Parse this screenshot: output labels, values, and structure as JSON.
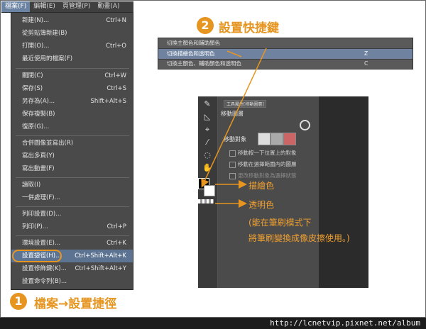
{
  "menubar": {
    "items": [
      {
        "label": "檔案(F)",
        "active": true
      },
      {
        "label": "編輯(E)",
        "active": false
      },
      {
        "label": "頁管理(P)",
        "active": false
      },
      {
        "label": "動畫(A)",
        "active": false
      }
    ]
  },
  "file_menu": {
    "items": [
      {
        "label": "新建(N)...",
        "shortcut": "Ctrl+N"
      },
      {
        "label": "從剪貼簿新建(B)",
        "shortcut": ""
      },
      {
        "label": "打開(O)...",
        "shortcut": "Ctrl+O"
      },
      {
        "label": "最近使用的檔案(F)",
        "shortcut": ""
      },
      {
        "label": "關閉(C)",
        "shortcut": "Ctrl+W"
      },
      {
        "label": "保存(S)",
        "shortcut": "Ctrl+S"
      },
      {
        "label": "另存為(A)...",
        "shortcut": "Shift+Alt+S"
      },
      {
        "label": "保存複製(B)",
        "shortcut": ""
      },
      {
        "label": "復原(G)...",
        "shortcut": ""
      },
      {
        "label": "合併圖像並寫出(R)",
        "shortcut": ""
      },
      {
        "label": "寫出多頁(Y)",
        "shortcut": ""
      },
      {
        "label": "寫出動畫(F)",
        "shortcut": ""
      },
      {
        "label": "讀取(I)",
        "shortcut": ""
      },
      {
        "label": "一併處理(F)...",
        "shortcut": ""
      },
      {
        "label": "列印設置(D)...",
        "shortcut": ""
      },
      {
        "label": "列印(P)...",
        "shortcut": "Ctrl+P"
      },
      {
        "label": "環境設置(E)...",
        "shortcut": "Ctrl+K"
      },
      {
        "label": "設置捷徑(H)...",
        "shortcut": "Ctrl+Shift+Alt+K"
      },
      {
        "label": "設置修飾鍵(K)...",
        "shortcut": "Ctrl+Shift+Alt+Y"
      },
      {
        "label": "設置命令列(B)...",
        "shortcut": ""
      }
    ]
  },
  "annotations": {
    "step1_number": "1",
    "step1_text": "檔案→設置捷徑",
    "step2_number": "2",
    "step2_text": "設置快捷鍵"
  },
  "shortcut_panel": {
    "rows": [
      {
        "label": "切換主顏色和輔助顏色",
        "key": ""
      },
      {
        "label": "切換描繪色和透明色",
        "key": "Z"
      },
      {
        "label": "切換主顏色、輔助顏色和透明色",
        "key": "C"
      }
    ]
  },
  "tool_panel": {
    "tab_label": "工具屬性[移動圖層]",
    "title": "移動圖層",
    "move_target_label": "移動對象",
    "options": [
      {
        "label": "移動按一下位置上的對象",
        "enabled": true
      },
      {
        "label": "移動在選擇範圍內的圖層",
        "enabled": true
      },
      {
        "label": "更改移動對象為選擇狀態",
        "enabled": false
      }
    ]
  },
  "labels": {
    "draw_color": "描繪色",
    "transparent_color": "透明色",
    "note_line1": "(能在筆刷模式下",
    "note_line2": "將筆刷變換成像皮擦使用。)"
  },
  "footer": {
    "url": "http://lcnetvip.pixnet.net/album"
  },
  "colors": {
    "accent_orange": "#e69520",
    "menu_bg": "#4a4a4a",
    "highlight": "#5d7392"
  }
}
